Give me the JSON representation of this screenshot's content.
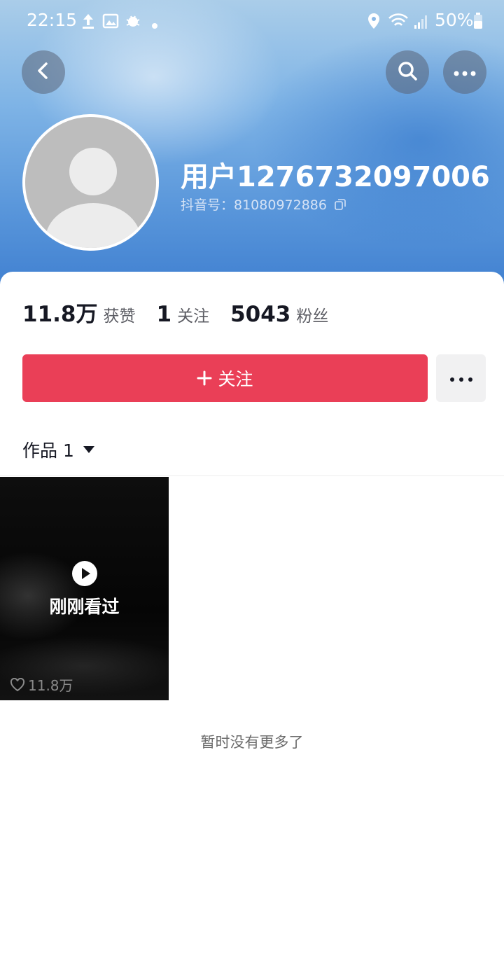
{
  "status_bar": {
    "time": "22:15",
    "battery": "50%",
    "icons": [
      "upload-icon",
      "image-icon",
      "bug-icon",
      "dot-icon",
      "location-icon",
      "wifi-icon",
      "signal-icon",
      "battery-icon"
    ]
  },
  "header": {
    "back_icon": "chevron-left-icon",
    "search_icon": "search-icon",
    "more_icon": "ellipsis-icon"
  },
  "profile": {
    "username": "用户1276732097006",
    "douyin_id": "抖音号：81080972886"
  },
  "stats": {
    "likes_num": "11.8万",
    "likes_label": "获赞",
    "following_num": "1",
    "following_label": "关注",
    "followers_num": "5043",
    "followers_label": "粉丝"
  },
  "actions": {
    "follow_label": "关注",
    "accent": "#ea3f57"
  },
  "works": {
    "tab_label": "作品 1",
    "items": [
      {
        "overlay": "刚刚看过",
        "likes": "11.8万"
      }
    ],
    "end_text": "暂时没有更多了"
  }
}
